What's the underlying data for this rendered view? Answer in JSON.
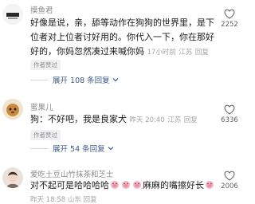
{
  "comments": [
    {
      "username": "摸鱼君",
      "lines": [
        "好像是说，亲，舔等动作在狗狗的世界里，是下",
        "位者对上位者讨好用的。你代入一下，你在那好",
        "好的，你妈忽然凑过来喊你妈"
      ],
      "time": "17小时前",
      "location": "江苏",
      "reply_label": "回复",
      "author_liked": "作者赞过",
      "expand": "展开 108 条回复",
      "likes": "2252"
    },
    {
      "username": "蜜果儿",
      "text": "狗：不好吧，我是良家犬",
      "time": "昨天 20:40",
      "location": "江苏",
      "reply_label": "回复",
      "author_liked": "作者赞过",
      "expand": "展开 54 条回复",
      "likes": "6336"
    },
    {
      "username": "爱吃土豆山竹抹茶和芝士",
      "text_a": "对不起可是哈哈哈哈",
      "text_b": "麻麻的嘴擦好长",
      "time": "昨天 18:58",
      "location": "山东",
      "reply_label": "回复",
      "likes": "2006"
    }
  ],
  "icons": {
    "like": "heart-outline-icon",
    "expand": "chevron-down-icon",
    "emoji": "pig-face-emoji-icon"
  },
  "colors": {
    "link": "#3e5a86",
    "meta": "#a3a3a3",
    "tag_bg": "#f1f1f3"
  }
}
